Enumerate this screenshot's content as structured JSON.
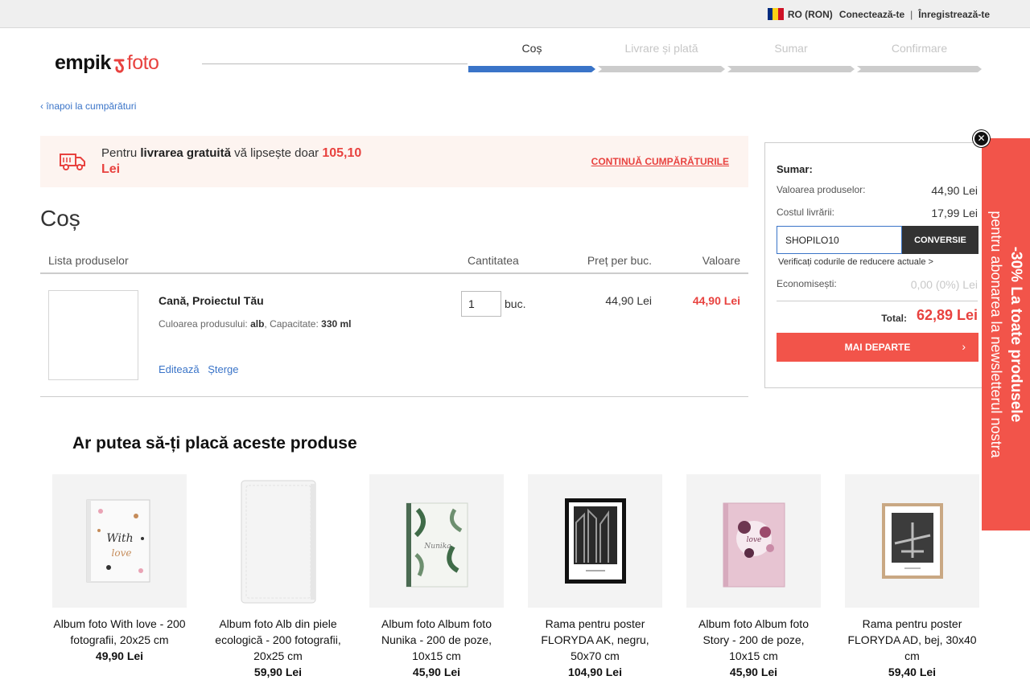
{
  "topbar": {
    "region": "RO (RON)",
    "login": "Conectează-te",
    "separator": "|",
    "register": "Înregistrează-te",
    "flag_colors": [
      "#002b7f",
      "#fcd116",
      "#ce1126"
    ]
  },
  "logo": {
    "part1": "empik",
    "mark": "ʢ",
    "part2": "foto"
  },
  "steps": [
    {
      "label": "Coș",
      "active": true
    },
    {
      "label": "Livrare și plată",
      "active": false
    },
    {
      "label": "Sumar",
      "active": false
    },
    {
      "label": "Confirmare",
      "active": false
    }
  ],
  "back_link": "‹ înapoi la cumpărături",
  "free_delivery": {
    "prefix": "Pentru ",
    "bold": "livrarea gratuită",
    "middle": " vă lipsește doar ",
    "amount": "105,10",
    "currency": "Lei",
    "continue_label": "CONTINUĂ CUMPĂRĂTURILE"
  },
  "page_title": "Coș",
  "cart": {
    "headers": {
      "products": "Lista produselor",
      "quantity": "Cantitatea",
      "unit_price": "Preț per buc.",
      "value": "Valoare"
    },
    "items": [
      {
        "name": "Cană, Proiectul Tău",
        "color_label": "Culoarea produsului: ",
        "color": "alb",
        "capacity_label": ", Capacitate: ",
        "capacity": "330 ml",
        "edit": "Editează",
        "delete": "Șterge",
        "quantity": "1",
        "unit": "buc.",
        "unit_price": "44,90 Lei",
        "total": "44,90 Lei"
      }
    ]
  },
  "summary": {
    "title": "Sumar:",
    "products_label": "Valoarea produselor:",
    "products_value": "44,90 Lei",
    "shipping_label": "Costul livrării:",
    "shipping_value": "17,99 Lei",
    "coupon_value": "SHOPILO10",
    "coupon_button": "CONVERSIE",
    "verify_link": "Verificați codurile de reducere actuale >",
    "savings_label": "Economisești:",
    "savings_value": "0,00 (0%) Lei",
    "total_label": "Total:",
    "total_value": "62,89 Lei",
    "next_button": "MAI DEPARTE",
    "next_chevron": "›"
  },
  "promo": {
    "line1": "-30% La toate produsele",
    "line2": "pentru abonarea la newsletterul nostra",
    "close": "✕"
  },
  "recommendations": {
    "title": "Ar putea să-ți placă aceste produse",
    "items": [
      {
        "name": "Album foto With love - 200 fotografii, 20x25 cm",
        "price": "49,90 Lei",
        "icon": "album-with-love-image"
      },
      {
        "name": "Album foto Alb din piele ecologică - 200 fotografii, 20x25 cm",
        "price": "59,90 Lei",
        "icon": "album-white-leather-image"
      },
      {
        "name": "Album foto Album foto Nunika - 200 de poze, 10x15 cm",
        "price": "45,90 Lei",
        "icon": "album-nunika-image"
      },
      {
        "name": "Rama pentru poster FLORYDA AK, negru, 50x70 cm",
        "price": "104,90 Lei",
        "icon": "frame-black-poster-image"
      },
      {
        "name": "Album foto Album foto Story - 200 de poze, 10x15 cm",
        "price": "45,90 Lei",
        "icon": "album-story-image"
      },
      {
        "name": "Rama pentru poster FLORYDA AD, bej, 30x40 cm",
        "price": "59,40 Lei",
        "icon": "frame-beige-poster-image"
      }
    ]
  },
  "colors": {
    "accent_red": "#e8423f",
    "button_red": "#f2544a",
    "link_blue": "#3a74c8",
    "step_active": "#3a74c8"
  }
}
